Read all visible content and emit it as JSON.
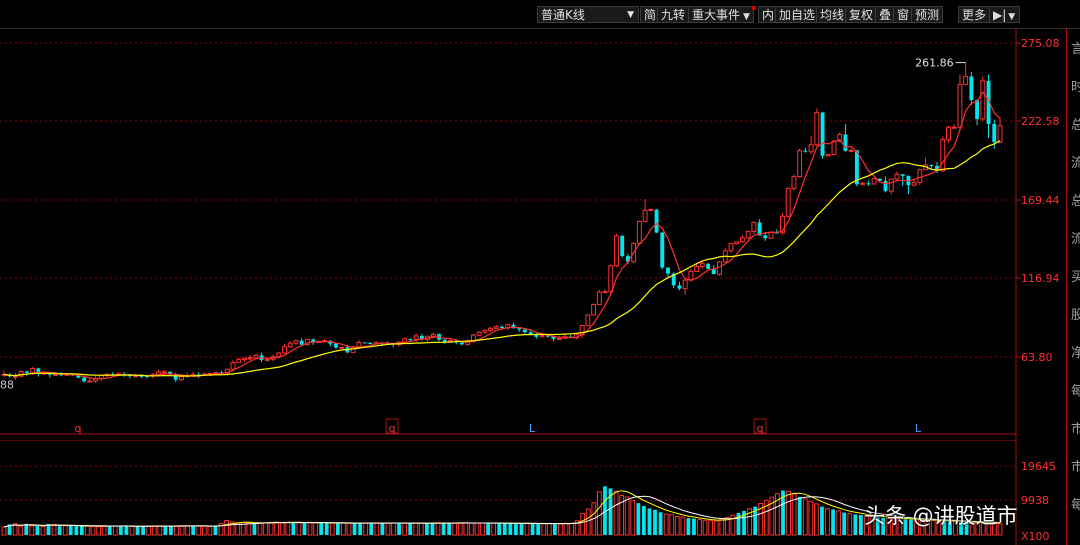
{
  "toolbar": {
    "period": "普通K线",
    "items": [
      "简",
      "九转",
      "重大事件",
      "内",
      "加自选",
      "均线",
      "复权",
      "叠",
      "窗",
      "预测",
      "更多"
    ]
  },
  "colors": {
    "up": "#ff3030",
    "down": "#00e5ee",
    "ma_fast": "#ff3030",
    "ma_slow": "#ffff00",
    "vol_ma_fast": "#ffff00",
    "vol_ma_slow": "#ffffff",
    "axis_text": "#ff3030",
    "grid": "#8b0000"
  },
  "side_chars": [
    "言",
    "时",
    "总",
    "流",
    "总",
    "流",
    "买",
    "股",
    "净",
    "每",
    "市",
    "市",
    "每"
  ],
  "markers": [
    "q",
    "q",
    "L",
    "q",
    "L"
  ],
  "watermark": "头条 @讲股道市",
  "chart_data": [
    {
      "type": "candlestick",
      "y_ticks": [
        "275.08",
        "222.58",
        "169.44",
        "116.94",
        "63.80"
      ],
      "ylim": [
        40,
        285
      ],
      "left_edge_label": "88",
      "max_annotation": "261.86",
      "candles": [
        [
          52.0,
          52.1,
          50.4,
          54.8
        ],
        [
          52.1,
          50.8,
          49.8,
          53.2
        ],
        [
          50.8,
          50.9,
          48.3,
          53.0
        ],
        [
          50.9,
          54.1,
          50.4,
          55.0
        ],
        [
          54.1,
          53.1,
          51.2,
          54.6
        ],
        [
          53.1,
          56.1,
          51.7,
          57.0
        ],
        [
          56.1,
          52.6,
          50.6,
          56.6
        ],
        [
          52.6,
          53.1,
          51.7,
          54.1
        ],
        [
          53.1,
          51.9,
          50.0,
          53.2
        ],
        [
          51.9,
          52.1,
          51.6,
          52.9
        ],
        [
          52.1,
          51.7,
          50.8,
          53.6
        ],
        [
          51.7,
          52.1,
          51.3,
          52.3
        ],
        [
          52.1,
          51.6,
          51.1,
          52.4
        ],
        [
          51.6,
          49.9,
          49.6,
          52.4
        ],
        [
          49.9,
          47.5,
          46.5,
          50.5
        ],
        [
          47.5,
          47.7,
          47.0,
          49.2
        ],
        [
          47.7,
          49.1,
          46.4,
          50.9
        ],
        [
          49.1,
          51.3,
          47.7,
          51.5
        ],
        [
          51.3,
          52.3,
          50.3,
          52.3
        ],
        [
          52.3,
          51.9,
          51.2,
          53.6
        ],
        [
          51.9,
          52.4,
          51.0,
          53.7
        ],
        [
          52.4,
          51.6,
          50.5,
          53.7
        ],
        [
          51.6,
          51.2,
          49.4,
          52.3
        ],
        [
          51.2,
          51.2,
          50.1,
          52.3
        ],
        [
          51.2,
          51.0,
          49.5,
          52.4
        ],
        [
          51.0,
          50.9,
          49.3,
          51.6
        ],
        [
          50.9,
          52.1,
          49.5,
          53.1
        ],
        [
          52.1,
          53.7,
          51.2,
          55.3
        ],
        [
          53.7,
          53.8,
          53.1,
          55.2
        ],
        [
          53.8,
          51.9,
          51.2,
          54.3
        ],
        [
          51.9,
          48.5,
          46.9,
          53.1
        ],
        [
          48.5,
          50.7,
          47.8,
          51.9
        ],
        [
          50.7,
          51.2,
          50.0,
          53.2
        ],
        [
          51.2,
          52.0,
          51.0,
          53.6
        ],
        [
          52.0,
          51.7,
          49.7,
          53.6
        ],
        [
          51.7,
          52.2,
          51.4,
          53.6
        ],
        [
          52.2,
          52.7,
          50.9,
          53.0
        ],
        [
          52.7,
          53.4,
          52.5,
          53.6
        ],
        [
          53.4,
          52.9,
          51.9,
          54.6
        ],
        [
          52.9,
          55.6,
          51.2,
          55.7
        ],
        [
          55.6,
          60.0,
          55.4,
          61.7
        ],
        [
          60.0,
          62.1,
          60.0,
          63.3
        ],
        [
          62.1,
          63.1,
          60.3,
          63.5
        ],
        [
          63.1,
          63.3,
          61.7,
          65.2
        ],
        [
          63.3,
          64.9,
          62.1,
          65.9
        ],
        [
          64.9,
          61.8,
          60.4,
          66.8
        ],
        [
          61.8,
          62.2,
          60.6,
          62.6
        ],
        [
          62.2,
          63.9,
          61.1,
          65.4
        ],
        [
          63.9,
          66.5,
          62.8,
          67.3
        ],
        [
          66.5,
          70.7,
          66.0,
          72.7
        ],
        [
          70.7,
          73.1,
          70.0,
          74.3
        ],
        [
          73.1,
          74.8,
          71.9,
          75.4
        ],
        [
          74.8,
          72.1,
          70.9,
          76.6
        ],
        [
          72.1,
          75.6,
          71.5,
          75.9
        ],
        [
          75.6,
          73.6,
          72.0,
          76.4
        ],
        [
          73.6,
          74.3,
          73.5,
          75.0
        ],
        [
          74.3,
          74.8,
          73.8,
          76.2
        ],
        [
          74.8,
          72.8,
          71.0,
          75.1
        ],
        [
          72.8,
          70.2,
          69.3,
          73.3
        ],
        [
          70.2,
          70.3,
          69.6,
          70.3
        ],
        [
          70.3,
          66.9,
          66.3,
          71.9
        ],
        [
          66.9,
          70.7,
          66.7,
          71.2
        ],
        [
          70.7,
          73.6,
          70.0,
          75.1
        ],
        [
          73.6,
          73.3,
          73.2,
          73.7
        ],
        [
          73.3,
          72.5,
          72.2,
          73.8
        ],
        [
          72.5,
          73.4,
          72.4,
          74.5
        ],
        [
          73.4,
          72.9,
          71.2,
          74.0
        ],
        [
          72.9,
          73.2,
          72.2,
          74.6
        ],
        [
          73.2,
          72.2,
          70.3,
          73.4
        ],
        [
          72.2,
          73.9,
          70.8,
          74.2
        ],
        [
          73.9,
          76.0,
          72.7,
          76.8
        ],
        [
          76.0,
          75.7,
          74.6,
          76.2
        ],
        [
          75.7,
          78.0,
          74.1,
          79.7
        ],
        [
          78.0,
          75.5,
          74.7,
          79.5
        ],
        [
          75.5,
          77.8,
          74.0,
          77.9
        ],
        [
          77.8,
          79.1,
          77.1,
          80.3
        ],
        [
          79.1,
          75.4,
          74.3,
          79.7
        ],
        [
          75.4,
          73.7,
          72.8,
          76.3
        ],
        [
          73.7,
          74.9,
          73.3,
          76.2
        ],
        [
          74.9,
          73.6,
          72.3,
          75.6
        ],
        [
          73.6,
          72.3,
          71.7,
          74.3
        ],
        [
          72.3,
          74.0,
          71.7,
          75.5
        ],
        [
          74.0,
          78.5,
          73.8,
          79.6
        ],
        [
          78.5,
          80.5,
          77.8,
          81.2
        ],
        [
          80.5,
          81.7,
          79.4,
          82.6
        ],
        [
          81.7,
          83.1,
          80.8,
          84.0
        ],
        [
          83.1,
          84.2,
          82.8,
          85.2
        ],
        [
          84.2,
          83.3,
          83.0,
          85.0
        ],
        [
          83.3,
          85.5,
          81.9,
          86.1
        ],
        [
          85.5,
          83.1,
          83.0,
          86.9
        ],
        [
          83.1,
          82.3,
          80.7,
          84.0
        ],
        [
          82.3,
          80.5,
          79.2,
          82.5
        ],
        [
          80.5,
          78.9,
          78.6,
          82.5
        ],
        [
          78.9,
          77.4,
          76.0,
          79.9
        ],
        [
          77.4,
          78.2,
          77.3,
          79.1
        ],
        [
          78.2,
          77.6,
          76.9,
          79.2
        ],
        [
          77.6,
          76.0,
          74.4,
          78.2
        ],
        [
          76.0,
          76.3,
          75.2,
          78.3
        ],
        [
          76.3,
          77.5,
          76.1,
          79.1
        ],
        [
          77.5,
          76.7,
          76.6,
          78.7
        ],
        [
          76.7,
          78.8,
          75.7,
          79.1
        ],
        [
          78.8,
          84.9,
          76.8,
          85.3
        ],
        [
          84.9,
          92.1,
          84.7,
          92.5
        ],
        [
          92.1,
          99.1,
          91.9,
          99.9
        ],
        [
          99.1,
          107.4,
          99.0,
          109.1
        ],
        [
          107.4,
          107.8,
          107.1,
          109.2
        ],
        [
          107.8,
          125.2,
          106.6,
          125.9
        ],
        [
          125.2,
          145.3,
          124.2,
          146.9
        ],
        [
          145.3,
          131.7,
          130.7,
          145.9
        ],
        [
          131.7,
          127.9,
          126.4,
          133.1
        ],
        [
          127.9,
          140.3,
          127.0,
          141.0
        ],
        [
          140.3,
          155.0,
          138.9,
          155.7
        ],
        [
          155.0,
          162.5,
          155.0,
          170.1
        ],
        [
          162.5,
          163.0,
          161.7,
          163.6
        ],
        [
          163.0,
          147.5,
          147.3,
          163.4
        ],
        [
          147.5,
          124.0,
          122.8,
          148.1
        ],
        [
          124.0,
          119.9,
          117.1,
          124.0
        ],
        [
          119.9,
          112.0,
          110.2,
          120.7
        ],
        [
          112.0,
          109.8,
          108.6,
          114.5
        ],
        [
          109.8,
          115.5,
          105.6,
          115.6
        ],
        [
          115.5,
          121.4,
          114.5,
          123.0
        ],
        [
          121.4,
          124.7,
          120.9,
          126.7
        ],
        [
          124.7,
          126.6,
          123.1,
          128.7
        ],
        [
          126.6,
          123.1,
          123.0,
          126.9
        ],
        [
          123.1,
          119.6,
          119.5,
          125.6
        ],
        [
          119.6,
          127.7,
          118.5,
          128.3
        ],
        [
          127.7,
          135.3,
          127.5,
          137.1
        ],
        [
          135.3,
          140.1,
          133.8,
          140.2
        ],
        [
          140.1,
          141.3,
          139.6,
          141.5
        ],
        [
          141.3,
          144.0,
          140.5,
          145.9
        ],
        [
          144.0,
          148.3,
          143.0,
          148.4
        ],
        [
          148.3,
          154.3,
          146.6,
          154.9
        ],
        [
          154.3,
          145.6,
          145.6,
          156.5
        ],
        [
          145.6,
          143.7,
          142.0,
          148.0
        ],
        [
          143.7,
          147.5,
          143.2,
          147.9
        ],
        [
          147.5,
          147.4,
          147.3,
          149.7
        ],
        [
          147.4,
          158.5,
          146.1,
          160.7
        ],
        [
          158.5,
          177.3,
          157.6,
          177.8
        ],
        [
          177.3,
          185.2,
          175.8,
          186.6
        ],
        [
          185.2,
          202.6,
          184.4,
          204.1
        ],
        [
          202.6,
          201.9,
          201.3,
          204.5
        ],
        [
          201.9,
          206.6,
          200.2,
          212.5
        ],
        [
          206.6,
          228.3,
          205.7,
          231.0
        ],
        [
          228.3,
          199.2,
          197.3,
          228.8
        ],
        [
          199.2,
          200.1,
          198.3,
          200.2
        ],
        [
          200.1,
          209.1,
          199.6,
          209.7
        ],
        [
          209.1,
          213.5,
          208.2,
          214.9
        ],
        [
          213.5,
          202.5,
          201.9,
          220.5
        ],
        [
          202.5,
          202.8,
          201.5,
          204.4
        ],
        [
          202.8,
          180.0,
          178.5,
          203.1
        ],
        [
          180.0,
          180.7,
          179.4,
          181.8
        ],
        [
          180.7,
          180.2,
          178.9,
          182.5
        ],
        [
          180.2,
          183.8,
          181.1,
          184.6
        ],
        [
          183.8,
          182.3,
          181.9,
          184.0
        ],
        [
          182.3,
          175.4,
          174.6,
          185.3
        ],
        [
          175.4,
          183.5,
          173.2,
          184.0
        ],
        [
          183.5,
          186.8,
          182.3,
          188.6
        ],
        [
          186.8,
          185.7,
          178.9,
          186.9
        ],
        [
          185.7,
          179.5,
          173.3,
          185.9
        ],
        [
          179.5,
          181.3,
          178.7,
          183.2
        ],
        [
          181.3,
          189.8,
          179.6,
          190.6
        ],
        [
          189.8,
          193.0,
          189.7,
          198.0
        ],
        [
          193.0,
          192.4,
          190.0,
          193.3
        ],
        [
          192.4,
          189.1,
          187.6,
          195.2
        ],
        [
          189.1,
          210.0,
          188.2,
          212.3
        ],
        [
          210.0,
          218.4,
          207.7,
          219.4
        ],
        [
          218.4,
          218.4,
          217.9,
          220.4
        ],
        [
          218.4,
          247.2,
          216.9,
          254.0
        ],
        [
          247.2,
          252.6,
          247.1,
          261.9
        ],
        [
          252.6,
          236.7,
          233.4,
          255.5
        ],
        [
          236.7,
          224.0,
          219.7,
          237.0
        ],
        [
          224.0,
          249.6,
          222.5,
          252.6
        ],
        [
          249.6,
          220.6,
          211.0,
          253.8
        ],
        [
          220.6,
          208.3,
          203.9,
          223.6
        ],
        [
          208.3,
          219.4,
          207.6,
          225.4
        ]
      ]
    },
    {
      "type": "volume",
      "y_ticks": [
        "19645",
        "9938",
        "X100"
      ],
      "ylim": [
        0,
        22000
      ],
      "values": [
        2314,
        3059,
        3223,
        2597,
        3183,
        2669,
        2566,
        2426,
        3160,
        3035,
        2542,
        2634,
        2575,
        2683,
        2624,
        2489,
        2440,
        2419,
        2627,
        2681,
        2580,
        2558,
        2510,
        2418,
        2540,
        2427,
        2549,
        2524,
        2605,
        2604,
        2646,
        2491,
        2649,
        2651,
        2559,
        2631,
        2522,
        2432,
        2501,
        3251,
        4138,
        3700,
        3545,
        3568,
        3502,
        3470,
        3375,
        3440,
        3554,
        3667,
        3594,
        3621,
        3681,
        3512,
        3475,
        3512,
        3475,
        3553,
        3430,
        3375,
        3309,
        3457,
        3418,
        3369,
        3411,
        3357,
        3483,
        3475,
        3434,
        3359,
        3392,
        3462,
        3401,
        3335,
        3437,
        3384,
        3285,
        3378,
        3477,
        3478,
        3438,
        3416,
        3459,
        3484,
        3388,
        3415,
        3426,
        3407,
        3403,
        3337,
        3326,
        3279,
        3321,
        3240,
        3322,
        3290,
        3275,
        3215,
        3260,
        3218,
        3226,
        3331,
        3347,
        4059,
        6151,
        7432,
        9211,
        12345,
        13901,
        13300,
        12500,
        11300,
        10900,
        9800,
        9100,
        8300,
        7600,
        7200,
        6500,
        6000,
        5800,
        5300,
        5100,
        4800,
        4700,
        4400,
        4200,
        4100,
        4000,
        4600,
        5000,
        5700,
        6300,
        6900,
        7500,
        8100,
        9000,
        9900,
        10800,
        11800,
        12700,
        12500,
        11700,
        10900,
        10300,
        9500,
        8900,
        8100,
        7500,
        7300,
        6900,
        6400,
        6100,
        5900,
        5700,
        5500,
        5300,
        5100,
        4900,
        4800,
        4700,
        4600,
        4500,
        4400,
        4300,
        4300,
        4200,
        4200,
        4100,
        4000,
        3900,
        3800,
        3700,
        3700,
        3600,
        3500,
        3400,
        3400,
        3300,
        3200
      ]
    }
  ]
}
